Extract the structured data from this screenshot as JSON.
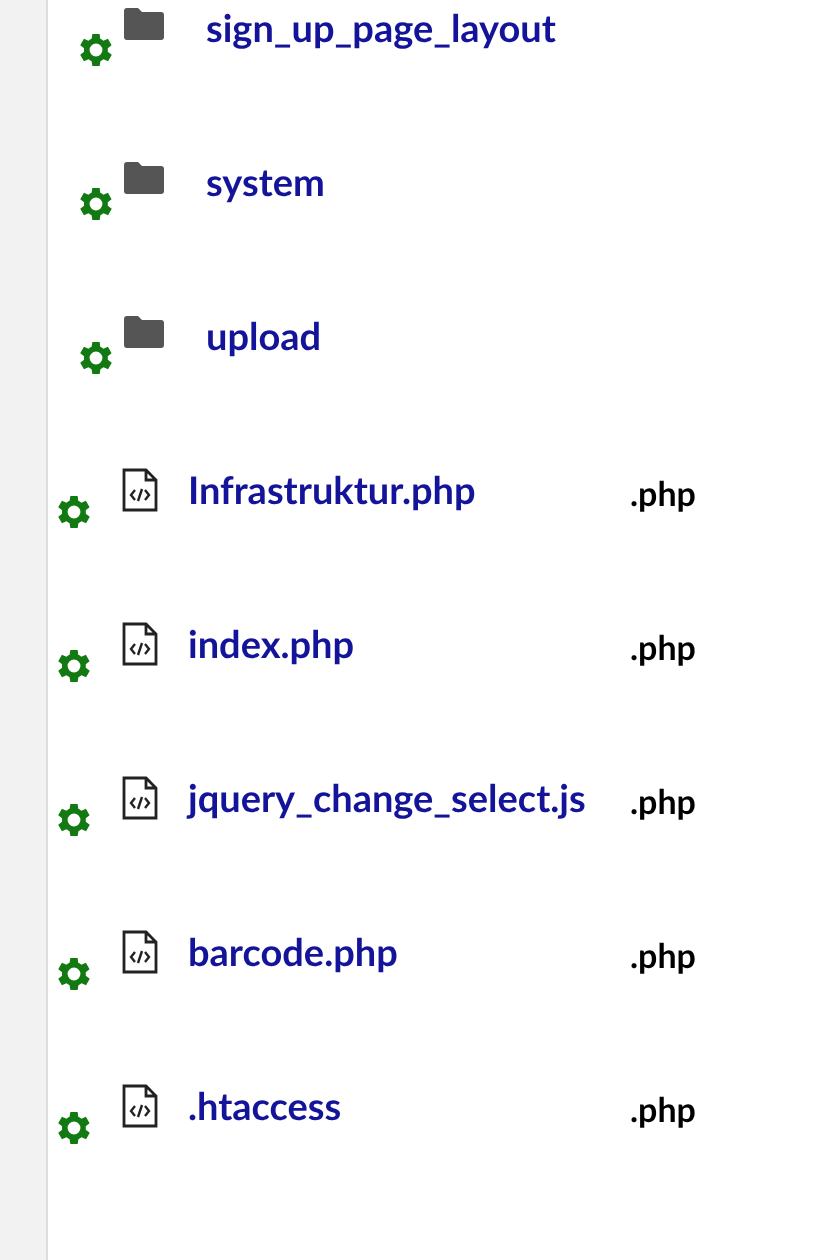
{
  "files": [
    {
      "kind": "folder",
      "name": "sign_up_page_layout"
    },
    {
      "kind": "folder",
      "name": "system"
    },
    {
      "kind": "folder",
      "name": "upload"
    },
    {
      "kind": "code",
      "name": "Infrastruktur.php",
      "extension": ".php"
    },
    {
      "kind": "code",
      "name": "index.php",
      "extension": ".php"
    },
    {
      "kind": "code",
      "name": "jquery_change_select.js",
      "extension": ".php"
    },
    {
      "kind": "code",
      "name": "barcode.php",
      "extension": ".php"
    },
    {
      "kind": "code",
      "name": ".htaccess",
      "extension": ".php"
    }
  ]
}
